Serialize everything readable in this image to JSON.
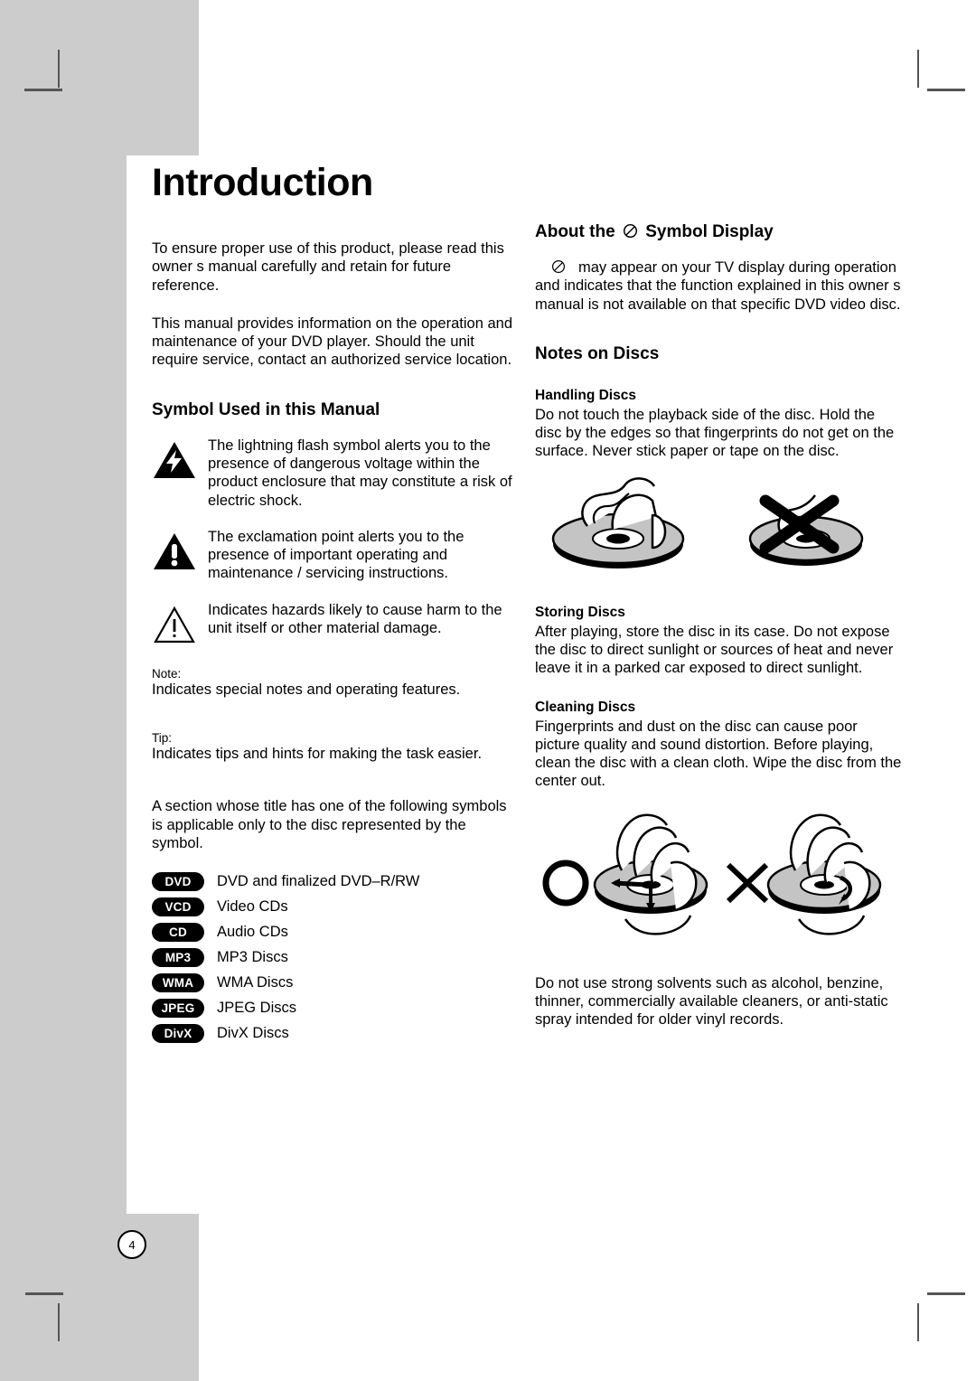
{
  "page": {
    "number": "4",
    "title": "Introduction"
  },
  "left_column": {
    "intro_paragraphs": [
      "To ensure proper use of this product, please read this owner s manual carefully and retain for future reference.",
      "This manual provides information on the operation and maintenance of your DVD player. Should the unit require service, contact an authorized service location."
    ],
    "symbol_section": {
      "heading": "Symbol Used in this Manual",
      "symbols": [
        {
          "icon": "lightning-bolt-triangle-icon",
          "text": "The lightning flash symbol alerts you to the presence of dangerous voltage within the product enclosure that may constitute a risk of electric shock."
        },
        {
          "icon": "exclamation-filled-triangle-icon",
          "text": "The exclamation point alerts you to the presence of important operating and maintenance / servicing instructions."
        },
        {
          "icon": "exclamation-outline-triangle-icon",
          "text": "Indicates hazards likely to cause harm to the unit itself or other material damage."
        }
      ],
      "note_label": "Note:",
      "note_text": "Indicates special notes and operating features.",
      "tip_label": "Tip:",
      "tip_text": "Indicates tips and hints for making the task easier.",
      "applicability_text": "A section whose title has one of the following symbols is applicable only to the disc represented by the symbol."
    },
    "disc_badges": [
      {
        "badge": "DVD",
        "label": "DVD and finalized DVD–R/RW"
      },
      {
        "badge": "VCD",
        "label": "Video CDs"
      },
      {
        "badge": "CD",
        "label": "Audio CDs"
      },
      {
        "badge": "MP3",
        "label": "MP3 Discs"
      },
      {
        "badge": "WMA",
        "label": "WMA Discs"
      },
      {
        "badge": "JPEG",
        "label": "JPEG Discs"
      },
      {
        "badge": "DivX",
        "label": "DivX Discs"
      }
    ]
  },
  "right_column": {
    "symbol_display": {
      "heading_before": "About the",
      "heading_symbol": "prohibition-circle-slash-icon",
      "heading_after": "Symbol Display",
      "body": "may appear on your TV display during operation and indicates that the function explained in this owner s manual is not available on that specific DVD video disc."
    },
    "notes_on_discs": {
      "heading": "Notes on Discs",
      "handling": {
        "title": "Handling Discs",
        "text": "Do not touch the playback side of the disc. Hold the disc by the edges so that fingerprints do not get on the surface. Never stick paper or tape on the disc."
      },
      "handling_illustration": {
        "correct": "hand-holding-disc-by-edge-icon",
        "incorrect": "disc-crossed-out-icon"
      },
      "storing": {
        "title": "Storing Discs",
        "text": "After playing, store the disc in its case. Do not expose the disc to direct sunlight or sources of heat and never leave it in a parked car exposed to direct sunlight."
      },
      "cleaning": {
        "title": "Cleaning Discs",
        "text": "Fingerprints and dust on the disc can cause poor picture quality and sound distortion. Before playing, clean the disc with a clean cloth. Wipe the disc from the center out."
      },
      "cleaning_illustration": {
        "correct_mark": "circle-ok-icon",
        "correct": "wipe-disc-center-out-icon",
        "incorrect_mark": "cross-x-icon",
        "incorrect": "wipe-disc-circular-icon"
      },
      "solvent_warning": "Do not use strong solvents such as alcohol, benzine, thinner, commercially available cleaners, or anti-static spray intended for older vinyl records."
    }
  },
  "colors": {
    "panel_gray": "#cccccc",
    "ink": "#000000",
    "disc_fill": "#c4c4c4",
    "crop_mark": "#555555"
  }
}
